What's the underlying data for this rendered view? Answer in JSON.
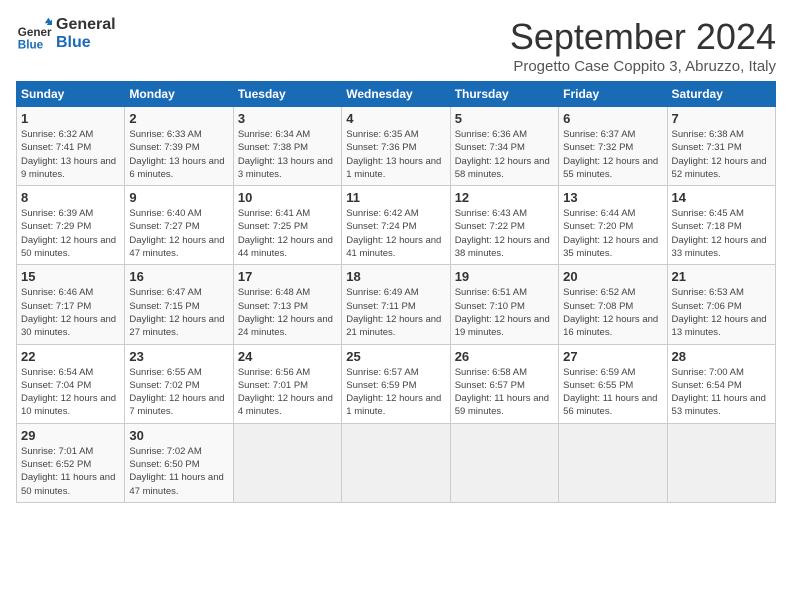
{
  "logo": {
    "line1": "General",
    "line2": "Blue"
  },
  "title": "September 2024",
  "subtitle": "Progetto Case Coppito 3, Abruzzo, Italy",
  "days_of_week": [
    "Sunday",
    "Monday",
    "Tuesday",
    "Wednesday",
    "Thursday",
    "Friday",
    "Saturday"
  ],
  "weeks": [
    [
      {
        "day": "1",
        "sunrise": "6:32 AM",
        "sunset": "7:41 PM",
        "daylight": "13 hours and 9 minutes."
      },
      {
        "day": "2",
        "sunrise": "6:33 AM",
        "sunset": "7:39 PM",
        "daylight": "13 hours and 6 minutes."
      },
      {
        "day": "3",
        "sunrise": "6:34 AM",
        "sunset": "7:38 PM",
        "daylight": "13 hours and 3 minutes."
      },
      {
        "day": "4",
        "sunrise": "6:35 AM",
        "sunset": "7:36 PM",
        "daylight": "13 hours and 1 minute."
      },
      {
        "day": "5",
        "sunrise": "6:36 AM",
        "sunset": "7:34 PM",
        "daylight": "12 hours and 58 minutes."
      },
      {
        "day": "6",
        "sunrise": "6:37 AM",
        "sunset": "7:32 PM",
        "daylight": "12 hours and 55 minutes."
      },
      {
        "day": "7",
        "sunrise": "6:38 AM",
        "sunset": "7:31 PM",
        "daylight": "12 hours and 52 minutes."
      }
    ],
    [
      {
        "day": "8",
        "sunrise": "6:39 AM",
        "sunset": "7:29 PM",
        "daylight": "12 hours and 50 minutes."
      },
      {
        "day": "9",
        "sunrise": "6:40 AM",
        "sunset": "7:27 PM",
        "daylight": "12 hours and 47 minutes."
      },
      {
        "day": "10",
        "sunrise": "6:41 AM",
        "sunset": "7:25 PM",
        "daylight": "12 hours and 44 minutes."
      },
      {
        "day": "11",
        "sunrise": "6:42 AM",
        "sunset": "7:24 PM",
        "daylight": "12 hours and 41 minutes."
      },
      {
        "day": "12",
        "sunrise": "6:43 AM",
        "sunset": "7:22 PM",
        "daylight": "12 hours and 38 minutes."
      },
      {
        "day": "13",
        "sunrise": "6:44 AM",
        "sunset": "7:20 PM",
        "daylight": "12 hours and 35 minutes."
      },
      {
        "day": "14",
        "sunrise": "6:45 AM",
        "sunset": "7:18 PM",
        "daylight": "12 hours and 33 minutes."
      }
    ],
    [
      {
        "day": "15",
        "sunrise": "6:46 AM",
        "sunset": "7:17 PM",
        "daylight": "12 hours and 30 minutes."
      },
      {
        "day": "16",
        "sunrise": "6:47 AM",
        "sunset": "7:15 PM",
        "daylight": "12 hours and 27 minutes."
      },
      {
        "day": "17",
        "sunrise": "6:48 AM",
        "sunset": "7:13 PM",
        "daylight": "12 hours and 24 minutes."
      },
      {
        "day": "18",
        "sunrise": "6:49 AM",
        "sunset": "7:11 PM",
        "daylight": "12 hours and 21 minutes."
      },
      {
        "day": "19",
        "sunrise": "6:51 AM",
        "sunset": "7:10 PM",
        "daylight": "12 hours and 19 minutes."
      },
      {
        "day": "20",
        "sunrise": "6:52 AM",
        "sunset": "7:08 PM",
        "daylight": "12 hours and 16 minutes."
      },
      {
        "day": "21",
        "sunrise": "6:53 AM",
        "sunset": "7:06 PM",
        "daylight": "12 hours and 13 minutes."
      }
    ],
    [
      {
        "day": "22",
        "sunrise": "6:54 AM",
        "sunset": "7:04 PM",
        "daylight": "12 hours and 10 minutes."
      },
      {
        "day": "23",
        "sunrise": "6:55 AM",
        "sunset": "7:02 PM",
        "daylight": "12 hours and 7 minutes."
      },
      {
        "day": "24",
        "sunrise": "6:56 AM",
        "sunset": "7:01 PM",
        "daylight": "12 hours and 4 minutes."
      },
      {
        "day": "25",
        "sunrise": "6:57 AM",
        "sunset": "6:59 PM",
        "daylight": "12 hours and 1 minute."
      },
      {
        "day": "26",
        "sunrise": "6:58 AM",
        "sunset": "6:57 PM",
        "daylight": "11 hours and 59 minutes."
      },
      {
        "day": "27",
        "sunrise": "6:59 AM",
        "sunset": "6:55 PM",
        "daylight": "11 hours and 56 minutes."
      },
      {
        "day": "28",
        "sunrise": "7:00 AM",
        "sunset": "6:54 PM",
        "daylight": "11 hours and 53 minutes."
      }
    ],
    [
      {
        "day": "29",
        "sunrise": "7:01 AM",
        "sunset": "6:52 PM",
        "daylight": "11 hours and 50 minutes."
      },
      {
        "day": "30",
        "sunrise": "7:02 AM",
        "sunset": "6:50 PM",
        "daylight": "11 hours and 47 minutes."
      },
      null,
      null,
      null,
      null,
      null
    ]
  ]
}
